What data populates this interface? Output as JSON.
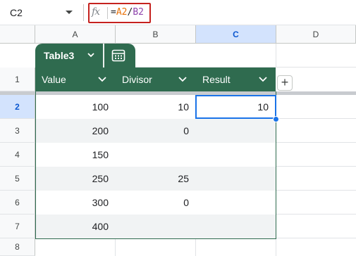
{
  "formula_bar": {
    "name_box": "C2",
    "fx_icon": "fx-icon",
    "formula": {
      "equals": "=",
      "ref1": "A2",
      "operator": "/",
      "ref2": "B2"
    },
    "colors": {
      "ref1": "#e8710a",
      "ref2": "#8e44ad",
      "highlight_border": "#c5221f"
    }
  },
  "columns": [
    {
      "label": "A",
      "selected": false
    },
    {
      "label": "B",
      "selected": false
    },
    {
      "label": "C",
      "selected": true
    },
    {
      "label": "D",
      "selected": false
    }
  ],
  "rows": [
    "1",
    "2",
    "3",
    "4",
    "5",
    "6",
    "7",
    "8"
  ],
  "selected_row": "2",
  "table": {
    "name": "Table3",
    "color": "#2f6b4f",
    "view_icon": "table-view-icon",
    "headers": [
      "Value",
      "Divisor",
      "Result"
    ],
    "rows": [
      {
        "value": "100",
        "divisor": "10",
        "result": "10"
      },
      {
        "value": "200",
        "divisor": "0",
        "result": ""
      },
      {
        "value": "150",
        "divisor": "",
        "result": ""
      },
      {
        "value": "250",
        "divisor": "25",
        "result": ""
      },
      {
        "value": "300",
        "divisor": "0",
        "result": ""
      },
      {
        "value": "400",
        "divisor": "",
        "result": ""
      }
    ]
  },
  "add_column_label": "+",
  "active_cell": "C2"
}
